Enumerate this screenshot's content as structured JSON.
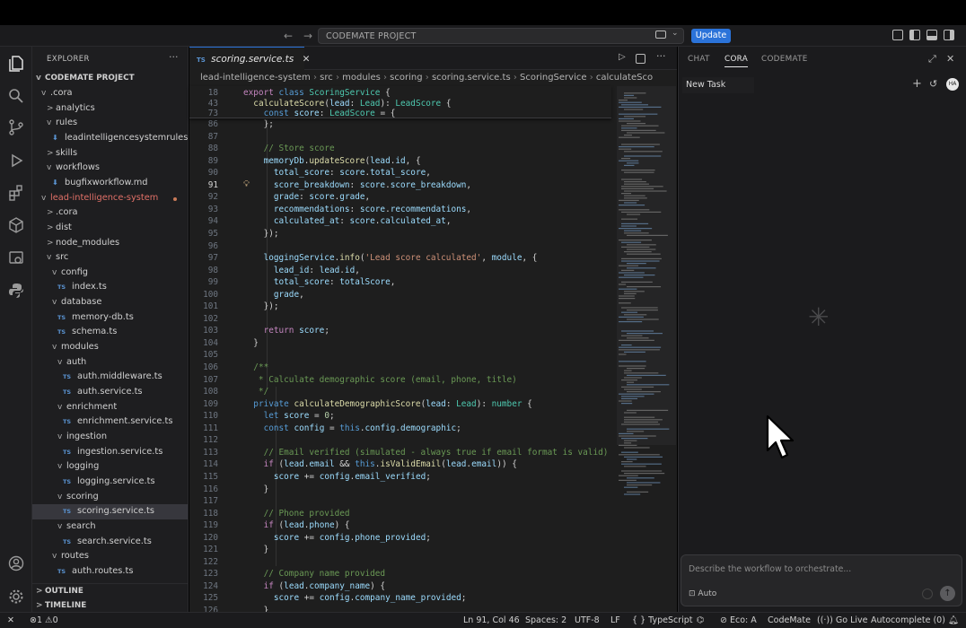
{
  "title_bar": {
    "back": "←",
    "forward": "→",
    "command_center": "CODEMATE PROJECT",
    "update_label": "Update"
  },
  "explorer": {
    "header": "EXPLORER",
    "project": "CODEMATE PROJECT",
    "tree": [
      {
        "indent": 0,
        "chev": "v",
        "label": ".cora",
        "kind": "folder"
      },
      {
        "indent": 1,
        "chev": ">",
        "label": "analytics",
        "kind": "folder"
      },
      {
        "indent": 1,
        "chev": "v",
        "label": "rules",
        "kind": "folder"
      },
      {
        "indent": 2,
        "chev": "",
        "label": "leadintelligencesystemrules....",
        "kind": "md"
      },
      {
        "indent": 1,
        "chev": ">",
        "label": "skills",
        "kind": "folder"
      },
      {
        "indent": 1,
        "chev": "v",
        "label": "workflows",
        "kind": "folder"
      },
      {
        "indent": 2,
        "chev": "",
        "label": "bugfixworkflow.md",
        "kind": "md"
      },
      {
        "indent": 0,
        "chev": "v",
        "label": "lead-intelligence-system",
        "kind": "folder-red"
      },
      {
        "indent": 1,
        "chev": ">",
        "label": ".cora",
        "kind": "folder"
      },
      {
        "indent": 1,
        "chev": ">",
        "label": "dist",
        "kind": "folder"
      },
      {
        "indent": 1,
        "chev": ">",
        "label": "node_modules",
        "kind": "folder"
      },
      {
        "indent": 1,
        "chev": "v",
        "label": "src",
        "kind": "folder"
      },
      {
        "indent": 2,
        "chev": "v",
        "label": "config",
        "kind": "folder"
      },
      {
        "indent": 3,
        "chev": "",
        "label": "index.ts",
        "kind": "ts"
      },
      {
        "indent": 2,
        "chev": "v",
        "label": "database",
        "kind": "folder"
      },
      {
        "indent": 3,
        "chev": "",
        "label": "memory-db.ts",
        "kind": "ts"
      },
      {
        "indent": 3,
        "chev": "",
        "label": "schema.ts",
        "kind": "ts"
      },
      {
        "indent": 2,
        "chev": "v",
        "label": "modules",
        "kind": "folder"
      },
      {
        "indent": 3,
        "chev": "v",
        "label": "auth",
        "kind": "folder"
      },
      {
        "indent": 4,
        "chev": "",
        "label": "auth.middleware.ts",
        "kind": "ts"
      },
      {
        "indent": 4,
        "chev": "",
        "label": "auth.service.ts",
        "kind": "ts"
      },
      {
        "indent": 3,
        "chev": "v",
        "label": "enrichment",
        "kind": "folder"
      },
      {
        "indent": 4,
        "chev": "",
        "label": "enrichment.service.ts",
        "kind": "ts"
      },
      {
        "indent": 3,
        "chev": "v",
        "label": "ingestion",
        "kind": "folder"
      },
      {
        "indent": 4,
        "chev": "",
        "label": "ingestion.service.ts",
        "kind": "ts"
      },
      {
        "indent": 3,
        "chev": "v",
        "label": "logging",
        "kind": "folder"
      },
      {
        "indent": 4,
        "chev": "",
        "label": "logging.service.ts",
        "kind": "ts"
      },
      {
        "indent": 3,
        "chev": "v",
        "label": "scoring",
        "kind": "folder"
      },
      {
        "indent": 4,
        "chev": "",
        "label": "scoring.service.ts",
        "kind": "ts",
        "selected": true
      },
      {
        "indent": 3,
        "chev": "v",
        "label": "search",
        "kind": "folder"
      },
      {
        "indent": 4,
        "chev": "",
        "label": "search.service.ts",
        "kind": "ts"
      },
      {
        "indent": 2,
        "chev": "v",
        "label": "routes",
        "kind": "folder"
      },
      {
        "indent": 3,
        "chev": "",
        "label": "auth.routes.ts",
        "kind": "ts"
      }
    ],
    "outline": "OUTLINE",
    "timeline": "TIMELINE"
  },
  "editor": {
    "tab_label": "scoring.service.ts",
    "tab_badge": "TS",
    "breadcrumb": [
      "lead-intelligence-system",
      "src",
      "modules",
      "scoring",
      "scoring.service.ts",
      "ScoringService",
      "calculateSco"
    ],
    "sticky": [
      {
        "n": "18",
        "t": "export class ScoringService {"
      },
      {
        "n": "43",
        "t": "  calculateScore(lead: Lead): LeadScore {"
      },
      {
        "n": "73",
        "t": "    const score: LeadScore = {"
      }
    ],
    "current_line": "91",
    "lines": [
      {
        "n": "86",
        "t": "    };"
      },
      {
        "n": "87",
        "t": ""
      },
      {
        "n": "88",
        "t": "    // Store score"
      },
      {
        "n": "89",
        "t": "    memoryDb.updateScore(lead.id, {"
      },
      {
        "n": "90",
        "t": "      total_score: score.total_score,"
      },
      {
        "n": "91",
        "t": "      score_breakdown: score.score_breakdown,"
      },
      {
        "n": "92",
        "t": "      grade: score.grade,"
      },
      {
        "n": "93",
        "t": "      recommendations: score.recommendations,"
      },
      {
        "n": "94",
        "t": "      calculated_at: score.calculated_at,"
      },
      {
        "n": "95",
        "t": "    });"
      },
      {
        "n": "96",
        "t": ""
      },
      {
        "n": "97",
        "t": "    loggingService.info('Lead score calculated', module, {"
      },
      {
        "n": "98",
        "t": "      lead_id: lead.id,"
      },
      {
        "n": "99",
        "t": "      total_score: totalScore,"
      },
      {
        "n": "100",
        "t": "      grade,"
      },
      {
        "n": "101",
        "t": "    });"
      },
      {
        "n": "102",
        "t": ""
      },
      {
        "n": "103",
        "t": "    return score;"
      },
      {
        "n": "104",
        "t": "  }"
      },
      {
        "n": "105",
        "t": ""
      },
      {
        "n": "106",
        "t": "  /**"
      },
      {
        "n": "107",
        "t": "   * Calculate demographic score (email, phone, title)"
      },
      {
        "n": "108",
        "t": "   */"
      },
      {
        "n": "109",
        "t": "  private calculateDemographicScore(lead: Lead): number {"
      },
      {
        "n": "110",
        "t": "    let score = 0;"
      },
      {
        "n": "111",
        "t": "    const config = this.config.demographic;"
      },
      {
        "n": "112",
        "t": ""
      },
      {
        "n": "113",
        "t": "    // Email verified (simulated - always true if email format is valid)"
      },
      {
        "n": "114",
        "t": "    if (lead.email && this.isValidEmail(lead.email)) {"
      },
      {
        "n": "115",
        "t": "      score += config.email_verified;"
      },
      {
        "n": "116",
        "t": "    }"
      },
      {
        "n": "117",
        "t": ""
      },
      {
        "n": "118",
        "t": "    // Phone provided"
      },
      {
        "n": "119",
        "t": "    if (lead.phone) {"
      },
      {
        "n": "120",
        "t": "      score += config.phone_provided;"
      },
      {
        "n": "121",
        "t": "    }"
      },
      {
        "n": "122",
        "t": ""
      },
      {
        "n": "123",
        "t": "    // Company name provided"
      },
      {
        "n": "124",
        "t": "    if (lead.company_name) {"
      },
      {
        "n": "125",
        "t": "      score += config.company_name_provided;"
      },
      {
        "n": "126",
        "t": "    }"
      }
    ]
  },
  "side_panel": {
    "tabs": [
      "CHAT",
      "CORA",
      "CODEMATE"
    ],
    "active_tab": "CORA",
    "task_title": "New Task",
    "avatar": "HA",
    "input_placeholder": "Describe the workflow to orchestrate...",
    "mode_label": "Auto"
  },
  "status_bar": {
    "errors": "1",
    "warnings": "0",
    "cursor": "Ln 91, Col 46",
    "spaces": "Spaces: 2",
    "encoding": "UTF-8",
    "eol": "LF",
    "language": "TypeScript",
    "eco": "Eco: A",
    "codemate": "CodeMate",
    "go_live": "Go Live",
    "autocomplete": "Autocomplete (0)"
  },
  "colors": {
    "accent": "#2b73d9",
    "keyword": "#569cd6",
    "function": "#dcdcaa",
    "type": "#4ec9b0",
    "property": "#9cdcfe",
    "string": "#ce9178",
    "comment": "#6a9955"
  }
}
